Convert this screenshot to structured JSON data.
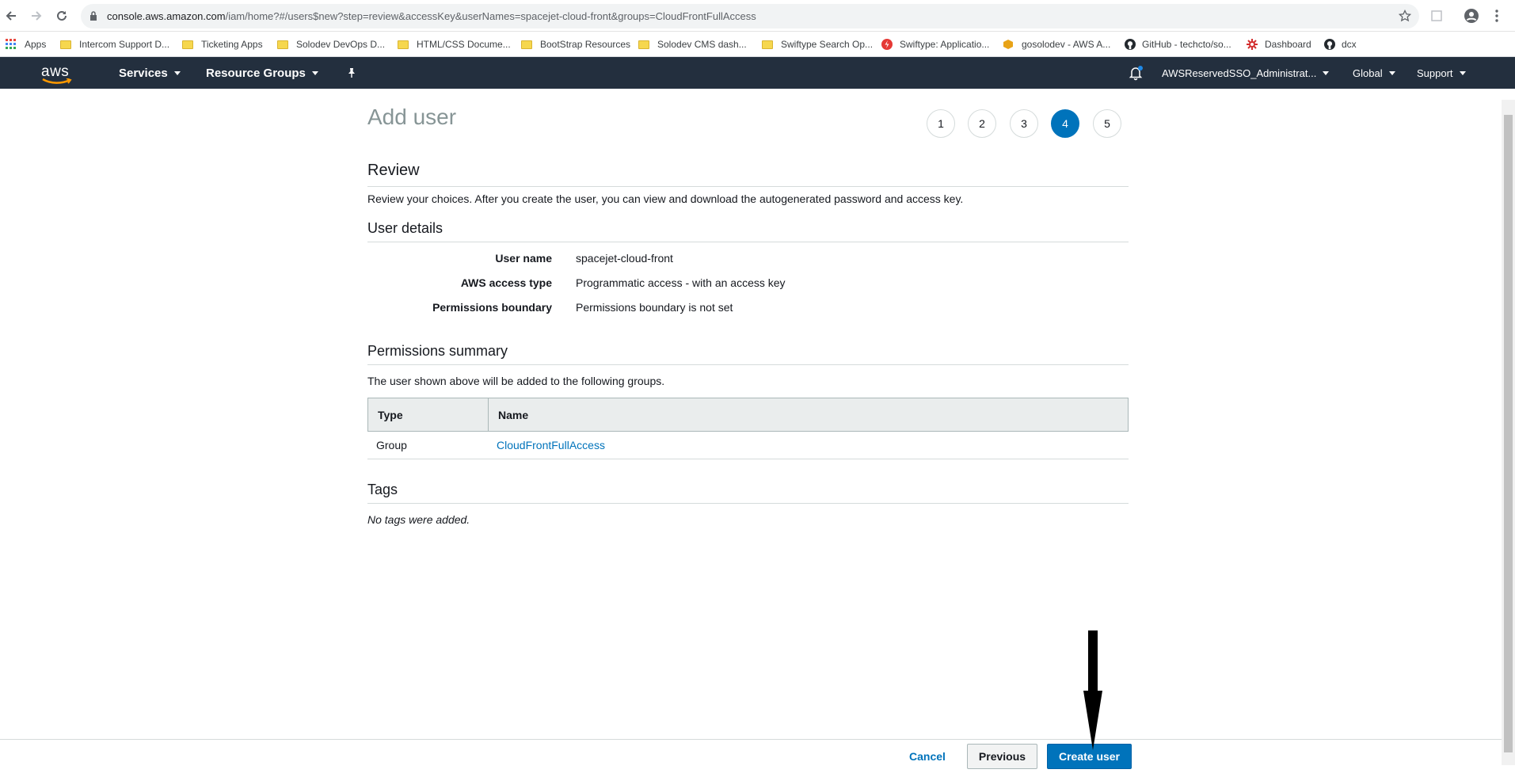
{
  "browser": {
    "url_host": "console.aws.amazon.com",
    "url_path": "/iam/home?#/users$new?step=review&accessKey&userNames=spacejet-cloud-front&groups=CloudFrontFullAccess"
  },
  "bookmarks": [
    {
      "label": "Apps",
      "icon": "apps-grid-icon"
    },
    {
      "label": "Intercom Support D...",
      "icon": "folder-icon"
    },
    {
      "label": "Ticketing Apps",
      "icon": "folder-icon"
    },
    {
      "label": "Solodev DevOps D...",
      "icon": "folder-icon"
    },
    {
      "label": "HTML/CSS Docume...",
      "icon": "folder-icon"
    },
    {
      "label": "BootStrap Resources",
      "icon": "folder-icon"
    },
    {
      "label": "Solodev CMS dash...",
      "icon": "folder-icon"
    },
    {
      "label": "Swiftype Search Op...",
      "icon": "folder-icon"
    },
    {
      "label": "Swiftype: Applicatio...",
      "icon": "swiftype-icon"
    },
    {
      "label": "gosolodev - AWS A...",
      "icon": "aws-box-icon"
    },
    {
      "label": "GitHub - techcto/so...",
      "icon": "github-icon"
    },
    {
      "label": "Dashboard",
      "icon": "dashboard-icon"
    },
    {
      "label": "dcx",
      "icon": "github-icon"
    }
  ],
  "aws_nav": {
    "logo": "aws",
    "services": "Services",
    "resource_groups": "Resource Groups",
    "account": "AWSReservedSSO_Administrat...",
    "region": "Global",
    "support": "Support"
  },
  "page": {
    "title": "Add user",
    "steps": [
      "1",
      "2",
      "3",
      "4",
      "5"
    ],
    "active_step": "4"
  },
  "review": {
    "heading": "Review",
    "description": "Review your choices. After you create the user, you can view and download the autogenerated password and access key."
  },
  "user_details": {
    "heading": "User details",
    "rows": [
      {
        "label": "User name",
        "value": "spacejet-cloud-front"
      },
      {
        "label": "AWS access type",
        "value": "Programmatic access - with an access key"
      },
      {
        "label": "Permissions boundary",
        "value": "Permissions boundary is not set"
      }
    ]
  },
  "permissions": {
    "heading": "Permissions summary",
    "description": "The user shown above will be added to the following groups.",
    "columns": [
      "Type",
      "Name"
    ],
    "rows": [
      {
        "type": "Group",
        "name": "CloudFrontFullAccess"
      }
    ]
  },
  "tags": {
    "heading": "Tags",
    "empty": "No tags were added."
  },
  "footer": {
    "cancel": "Cancel",
    "previous": "Previous",
    "create": "Create user"
  },
  "colors": {
    "aws_nav_bg": "#232f3e",
    "primary_blue": "#0073bb"
  }
}
